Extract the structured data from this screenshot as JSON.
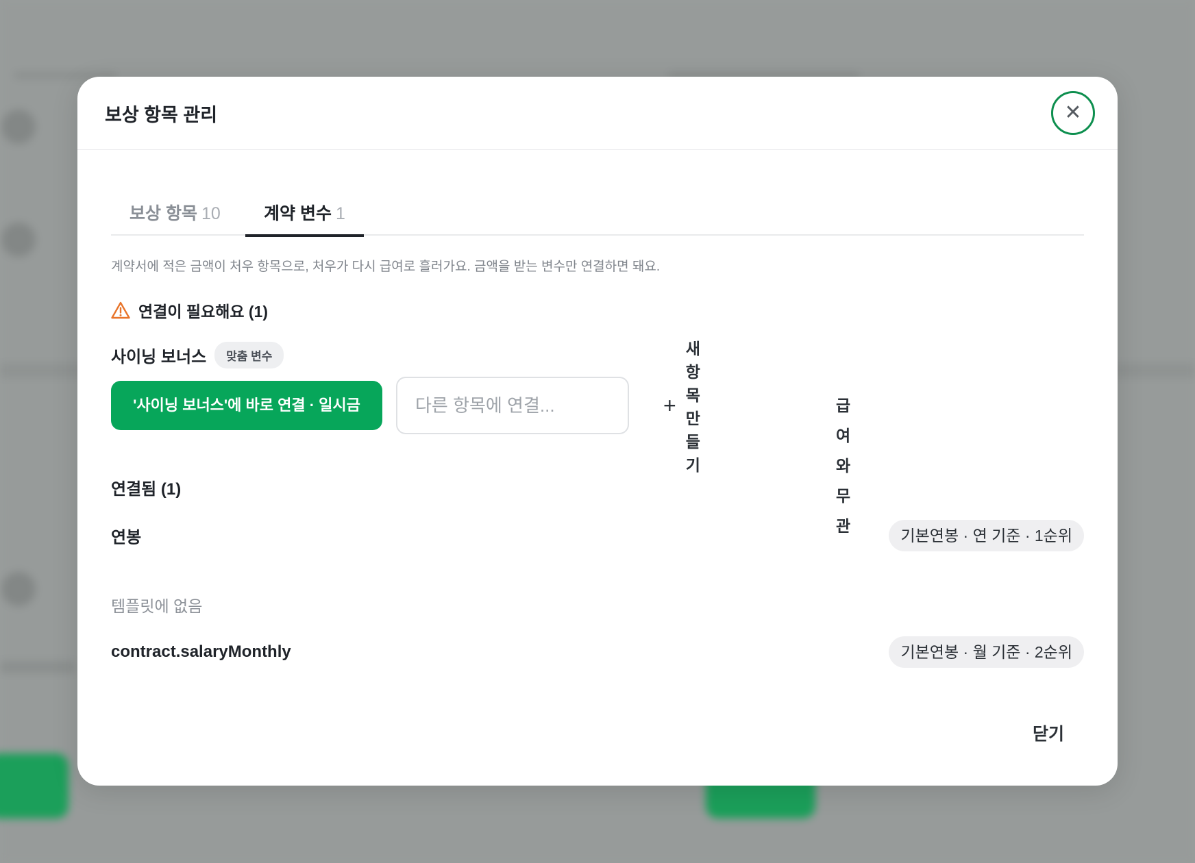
{
  "modal": {
    "title": "보상 항목 관리",
    "close_icon": "close-icon"
  },
  "tabs": [
    {
      "label": "보상 항목",
      "count": "10",
      "active": false
    },
    {
      "label": "계약 변수",
      "count": "1",
      "active": true
    }
  ],
  "description": "계약서에 적은 금액이 처우 항목으로, 처우가 다시 급여로 흘러가요. 금액을 받는 변수만 연결하면 돼요.",
  "needs_link": {
    "icon": "warning-icon",
    "heading": "연결이 필요해요 (1)",
    "variable": {
      "name": "사이닝 보너스",
      "badge": "맞춤 변수"
    },
    "actions": {
      "primary_label": "'사이닝 보너스'에 바로 연결 · 일시금",
      "input_placeholder": "다른 항목에 연결...",
      "new_item_label": "새 항목 만들기",
      "new_item_icon": "plus-icon",
      "unrelated_label": "급여와 무관"
    }
  },
  "connected": {
    "heading": "연결됨 (1)",
    "items": [
      {
        "name": "연봉",
        "chip": "기본연봉 · 연 기준 · 1순위"
      }
    ],
    "not_in_template_label": "템플릿에 없음",
    "not_in_template_items": [
      {
        "name": "contract.salaryMonthly",
        "chip": "기본연봉 · 월 기준 · 2순위"
      }
    ]
  },
  "footer": {
    "close_label": "닫기"
  },
  "colors": {
    "primary": "#07a65a",
    "close_ring": "#0e8f4f",
    "warning": "#e8742a"
  }
}
